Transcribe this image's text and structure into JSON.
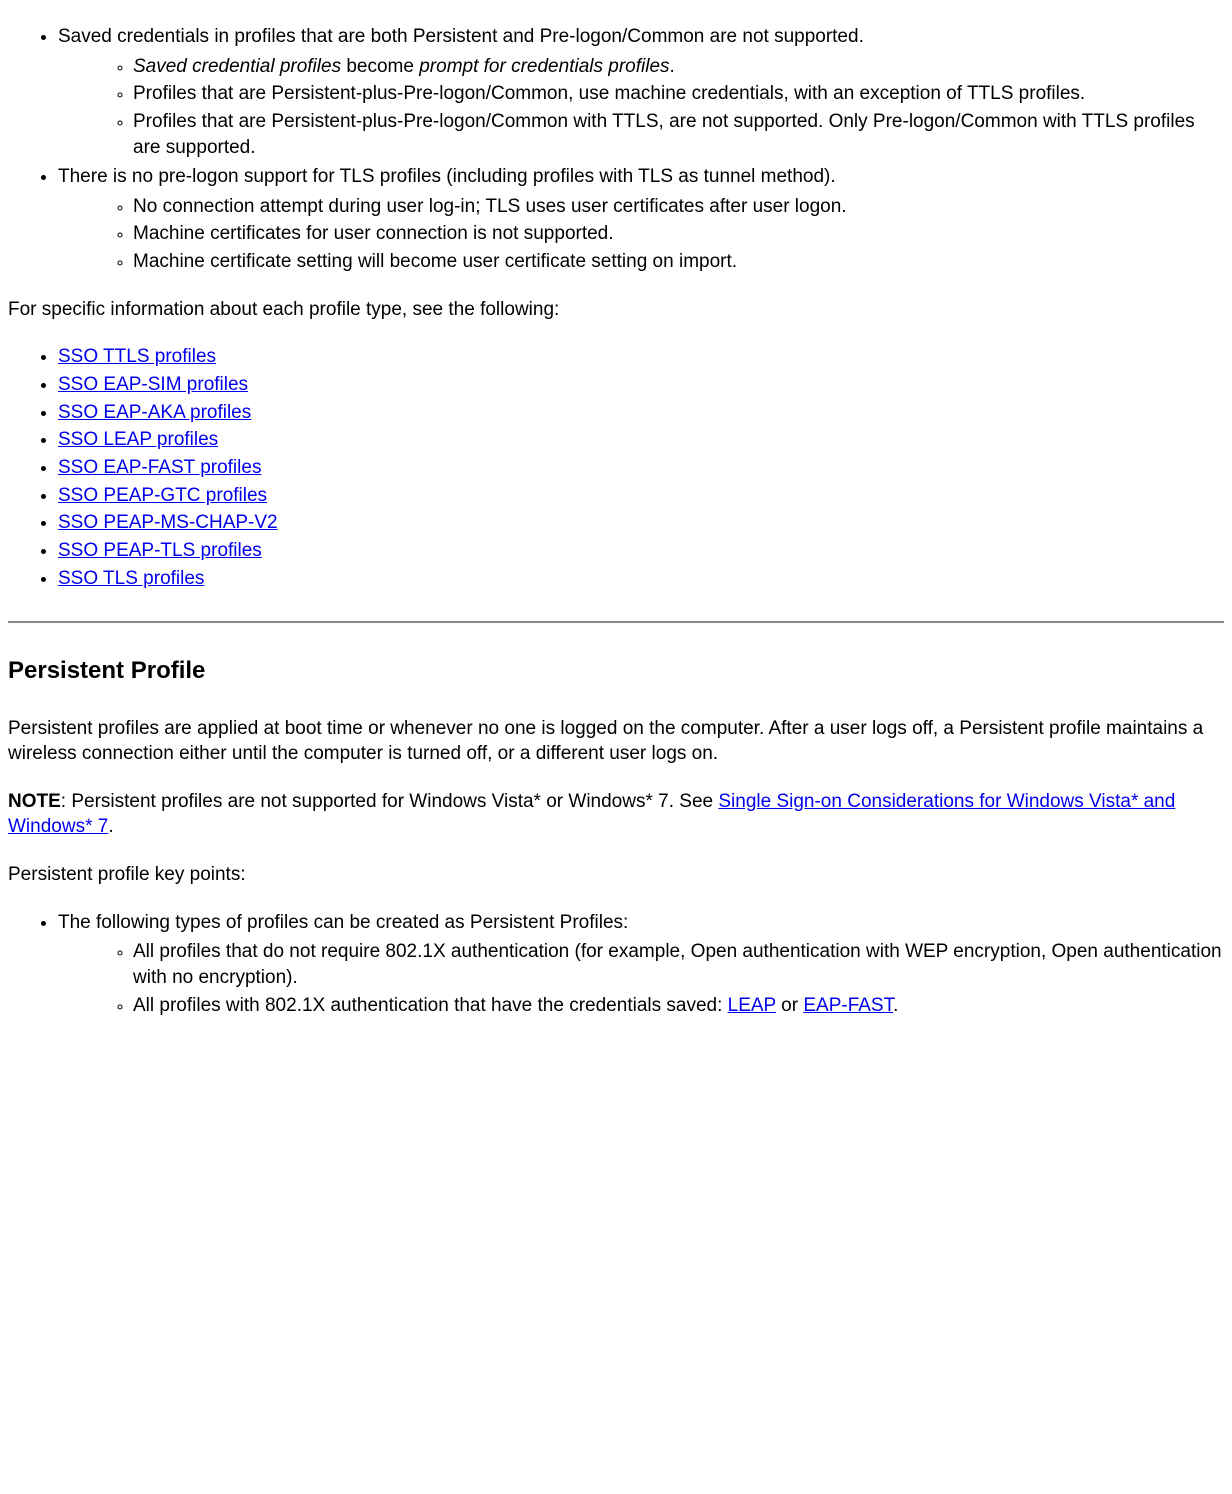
{
  "top_list": {
    "item1": "Saved credentials in profiles that are both Persistent and Pre-logon/Common are not supported.",
    "item1_sub1_a": "Saved credential profiles",
    "item1_sub1_b": " become ",
    "item1_sub1_c": "prompt for credentials profiles",
    "item1_sub1_d": ".",
    "item1_sub2": "Profiles that are Persistent-plus-Pre-logon/Common, use machine credentials, with an exception of TTLS profiles.",
    "item1_sub3": "Profiles that are Persistent-plus-Pre-logon/Common with TTLS, are not supported. Only Pre-logon/Common with TTLS profiles are supported.",
    "item2": "There is no pre-logon support for TLS profiles (including profiles with TLS as tunnel method).",
    "item2_sub1": "No connection attempt during user log-in; TLS uses user certificates after user logon.",
    "item2_sub2": "Machine certificates for user connection is not supported.",
    "item2_sub3": "Machine certificate setting will become user certificate setting on import."
  },
  "intro_paragraph": "For specific information about each profile type, see the following:",
  "sso_links": {
    "l1": "SSO TTLS profiles",
    "l2": "SSO EAP-SIM profiles",
    "l3": "SSO EAP-AKA profiles",
    "l4": "SSO LEAP profiles",
    "l5": "SSO EAP-FAST profiles",
    "l6": "SSO PEAP-GTC profiles",
    "l7": "SSO PEAP-MS-CHAP-V2",
    "l8": "SSO PEAP-TLS profiles",
    "l9": "SSO TLS profiles"
  },
  "persistent": {
    "heading": "Persistent Profile",
    "p1": "Persistent profiles are applied at boot time or whenever no one is logged on the computer. After a user logs off, a Persistent profile maintains a wireless connection either until the computer is turned off, or a different user logs on.",
    "note_label": "NOTE",
    "note_text": ": Persistent profiles are not supported for Windows Vista* or Windows* 7. See ",
    "note_link": "Single Sign-on Considerations for Windows Vista* and Windows* 7",
    "note_after": ".",
    "key_points_intro": "Persistent profile key points:",
    "kp1": "The following types of profiles can be created as Persistent Profiles:",
    "kp1_sub1": "All profiles that do not require 802.1X authentication (for example, Open authentication with WEP encryption, Open authentication with no encryption).",
    "kp1_sub2_a": "All profiles with 802.1X authentication that have the credentials saved: ",
    "kp1_sub2_link1": "LEAP",
    "kp1_sub2_b": " or ",
    "kp1_sub2_link2": "EAP-FAST",
    "kp1_sub2_c": "."
  }
}
